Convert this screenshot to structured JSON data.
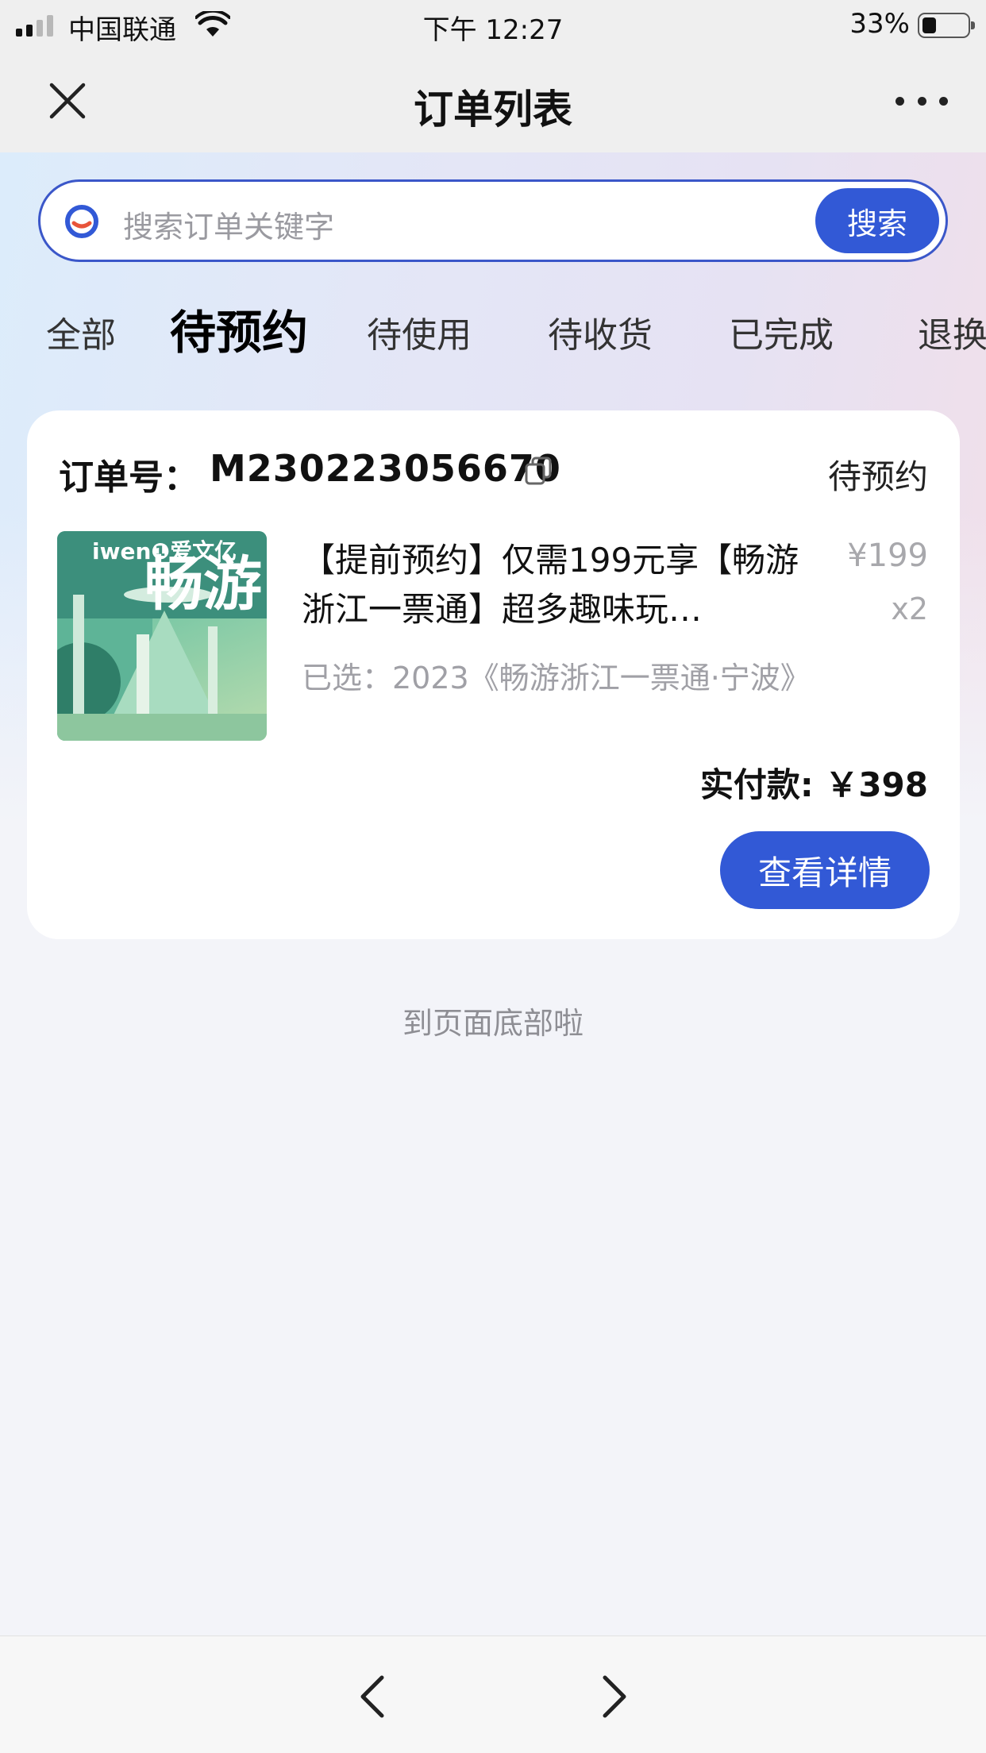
{
  "status_bar": {
    "carrier": "中国联通",
    "time": "下午 12:27",
    "battery_percent": "33%",
    "battery_level": 0.33
  },
  "nav": {
    "title": "订单列表",
    "close_icon": "close-icon",
    "more_icon": "more-icon"
  },
  "search": {
    "placeholder": "搜索订单关键字",
    "button_label": "搜索",
    "icon": "search-icon"
  },
  "tabs": [
    {
      "label": "全部",
      "active": false
    },
    {
      "label": "待预约",
      "active": true
    },
    {
      "label": "待使用",
      "active": false
    },
    {
      "label": "待收货",
      "active": false
    },
    {
      "label": "已完成",
      "active": false
    },
    {
      "label": "退换",
      "active": false
    }
  ],
  "order": {
    "order_no_label": "订单号：",
    "order_no": "M230223056670",
    "status": "待预约",
    "item": {
      "title": "【提前预约】仅需199元享【畅游浙江一票通】超多趣味玩…",
      "price": "¥199",
      "quantity": "x2",
      "spec": "已选：2023《畅游浙江一票通·宁波》",
      "thumb_logo": "iwen❶爱文亿",
      "thumb_text": "畅游"
    },
    "paid_label": "实付款: ￥398",
    "detail_button": "查看详情"
  },
  "end_text": "到页面底部啦",
  "colors": {
    "accent": "#3259d6",
    "search_border": "#3b57c9"
  }
}
